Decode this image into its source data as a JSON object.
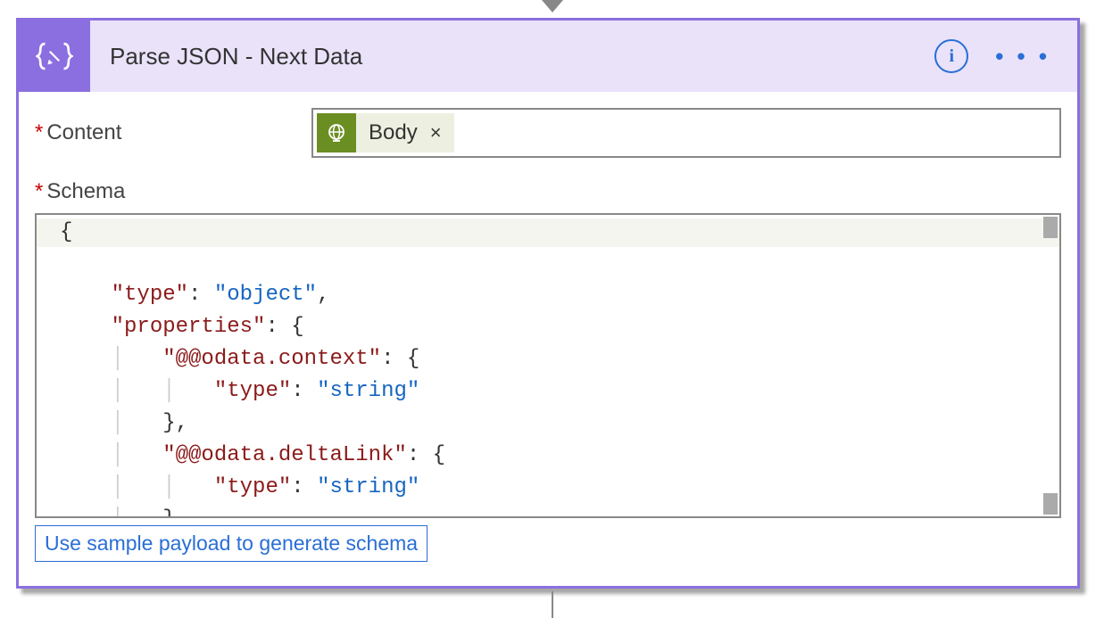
{
  "header": {
    "title": "Parse JSON - Next Data"
  },
  "fields": {
    "content_label": "Content",
    "schema_label": "Schema"
  },
  "token": {
    "label": "Body",
    "remove": "×"
  },
  "schema": {
    "l0": "{",
    "l1_k": "\"type\"",
    "l1_v": "\"object\"",
    "l2_k": "\"properties\"",
    "l3_k": "\"@@odata.context\"",
    "l4_k": "\"type\"",
    "l4_v": "\"string\"",
    "l5": "},",
    "l6_k": "\"@@odata.deltaLink\"",
    "l7_k": "\"type\"",
    "l7_v": "\"string\"",
    "l8": "},"
  },
  "actions": {
    "sample_link": "Use sample payload to generate schema"
  },
  "info_glyph": "i",
  "more_glyph": "• • •"
}
